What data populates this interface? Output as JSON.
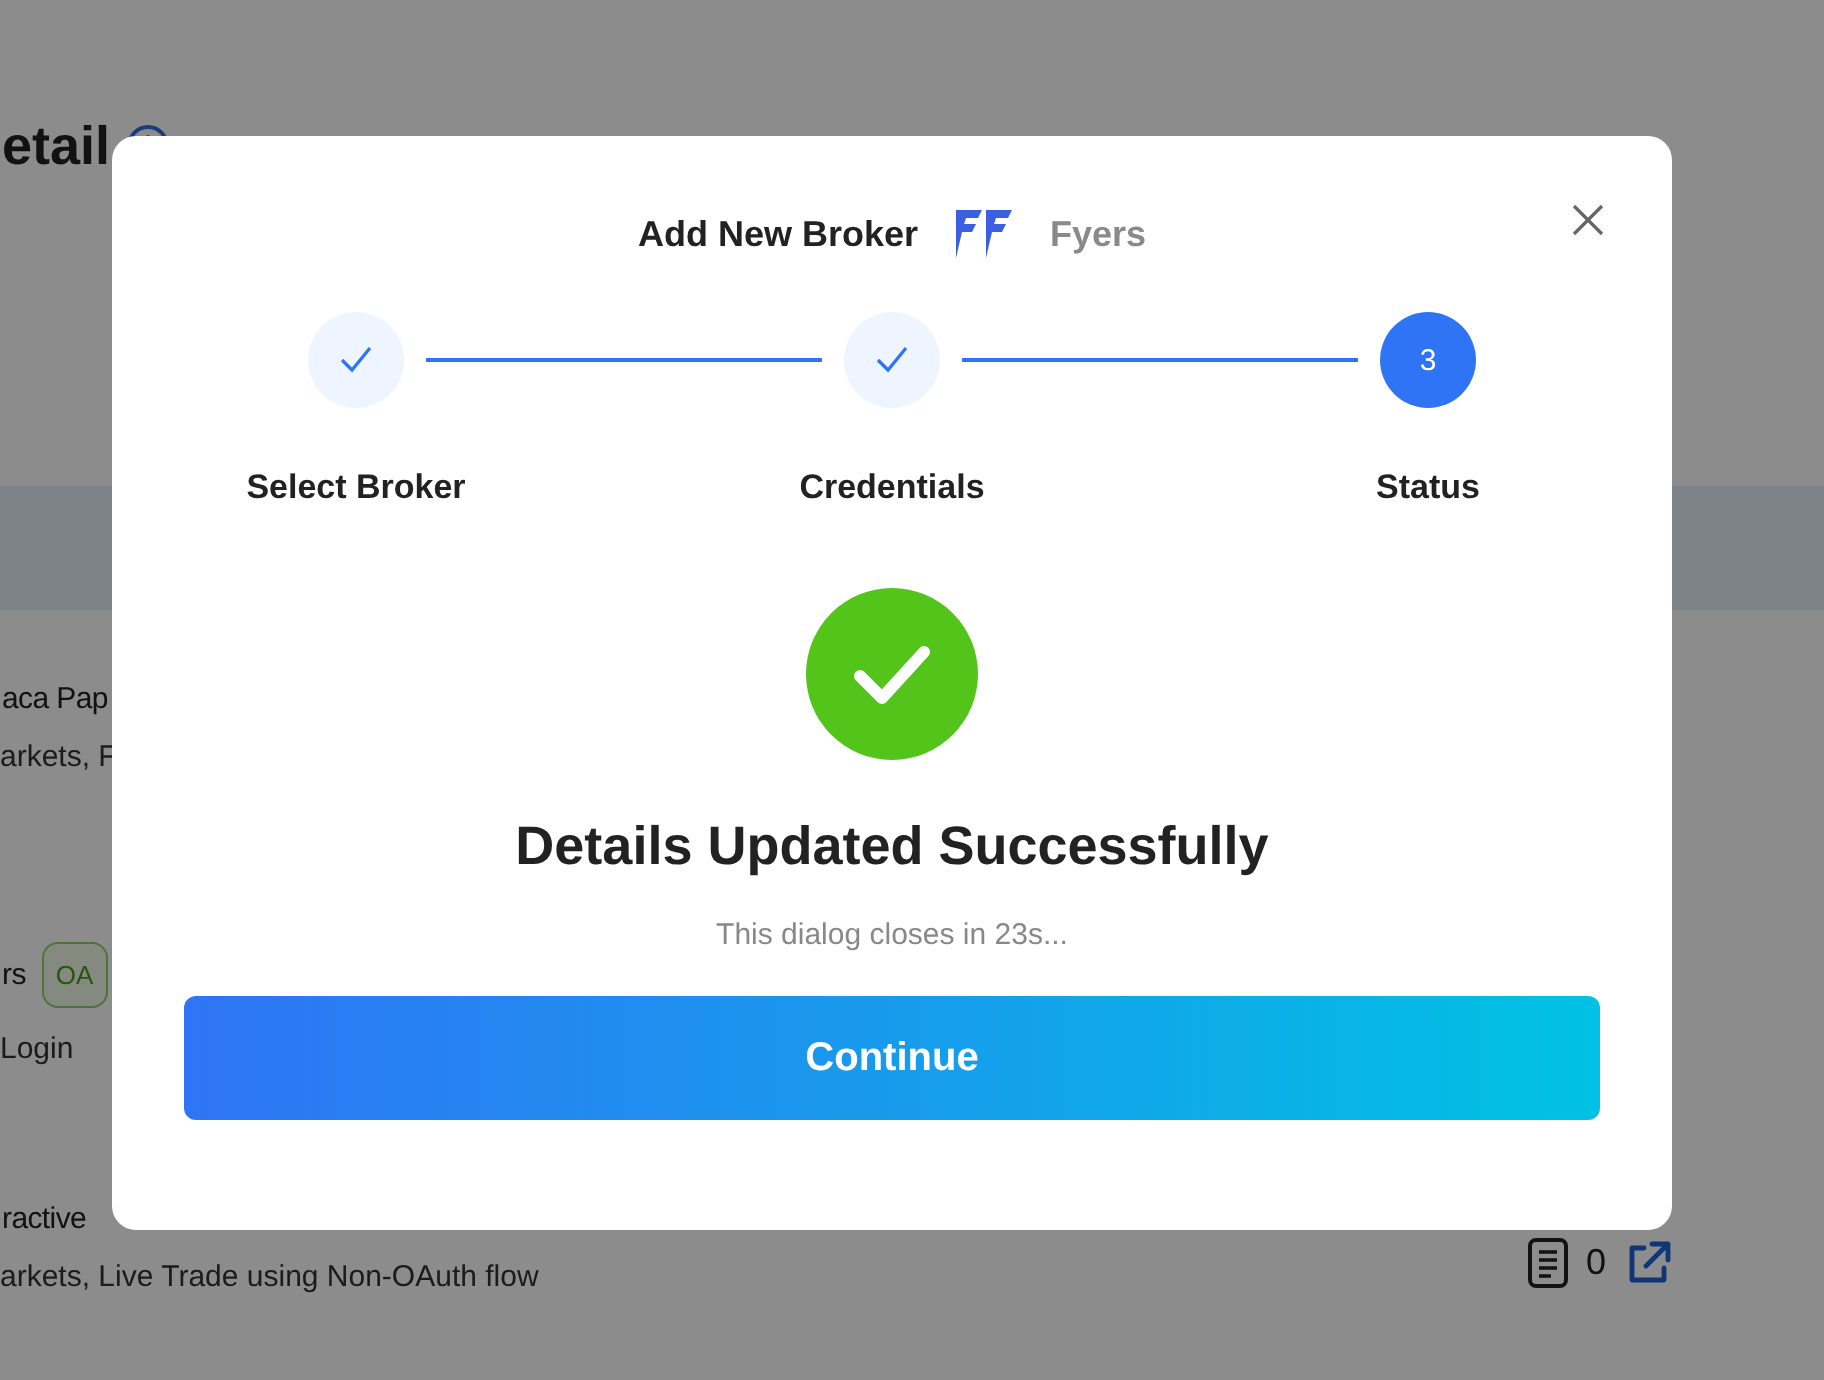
{
  "page": {
    "title": "etail",
    "rows": [
      {
        "title": "aca Pap",
        "subtitle": "arkets, F"
      },
      {
        "title": "rs",
        "badge": "OA",
        "subtitle": "Login"
      },
      {
        "title": "ractive",
        "subtitle": "arkets, Live Trade using Non-OAuth flow",
        "count": "0"
      }
    ]
  },
  "dialog": {
    "title": "Add New Broker",
    "broker": "Fyers",
    "steps": [
      {
        "label": "Select Broker",
        "completed": true
      },
      {
        "label": "Credentials",
        "completed": true
      },
      {
        "label": "Status",
        "completed": false,
        "number": "3"
      }
    ],
    "heading": "Details Updated Successfully",
    "note": "This dialog closes in 23s...",
    "button": "Continue"
  }
}
